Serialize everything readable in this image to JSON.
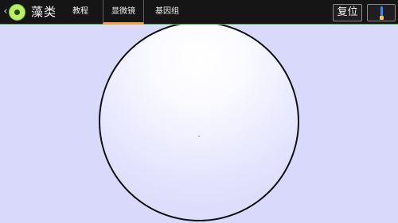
{
  "app": {
    "title": "藻类"
  },
  "tabs": [
    {
      "label": "教程",
      "selected": false
    },
    {
      "label": "显微镜",
      "selected": true
    },
    {
      "label": "基因组",
      "selected": false
    }
  ],
  "toolbar": {
    "reset_label": "复位",
    "light_icon": "lamp-icon"
  },
  "colors": {
    "header_bg": "#151515",
    "accent_orange": "#f1a43a",
    "logo_green": "#b9f060",
    "background": "#d9d9fb"
  }
}
